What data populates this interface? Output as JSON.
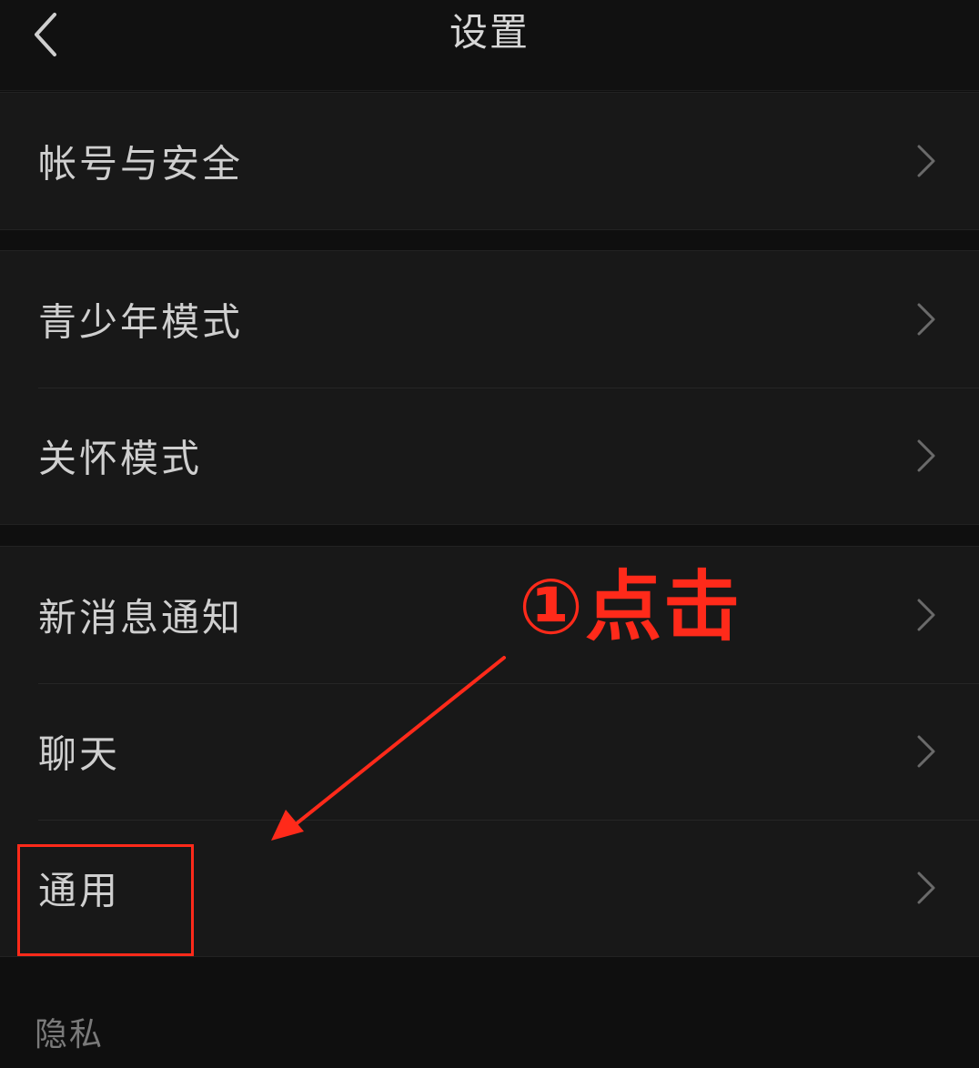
{
  "header": {
    "title": "设置",
    "back_icon": "chevron-left-icon"
  },
  "groups": [
    {
      "items": [
        {
          "label": "帐号与安全"
        }
      ]
    },
    {
      "items": [
        {
          "label": "青少年模式"
        },
        {
          "label": "关怀模式"
        }
      ]
    },
    {
      "items": [
        {
          "label": "新消息通知"
        },
        {
          "label": "聊天"
        },
        {
          "label": "通用"
        }
      ]
    }
  ],
  "section_privacy": {
    "label": "隐私"
  },
  "annotation": {
    "text": "①点击",
    "color": "#ff2a1a",
    "target": "通用"
  },
  "colors": {
    "background": "#0f0f0f",
    "row_background": "#181818",
    "text": "#cfcfcf",
    "chevron": "#6a6a6a"
  }
}
